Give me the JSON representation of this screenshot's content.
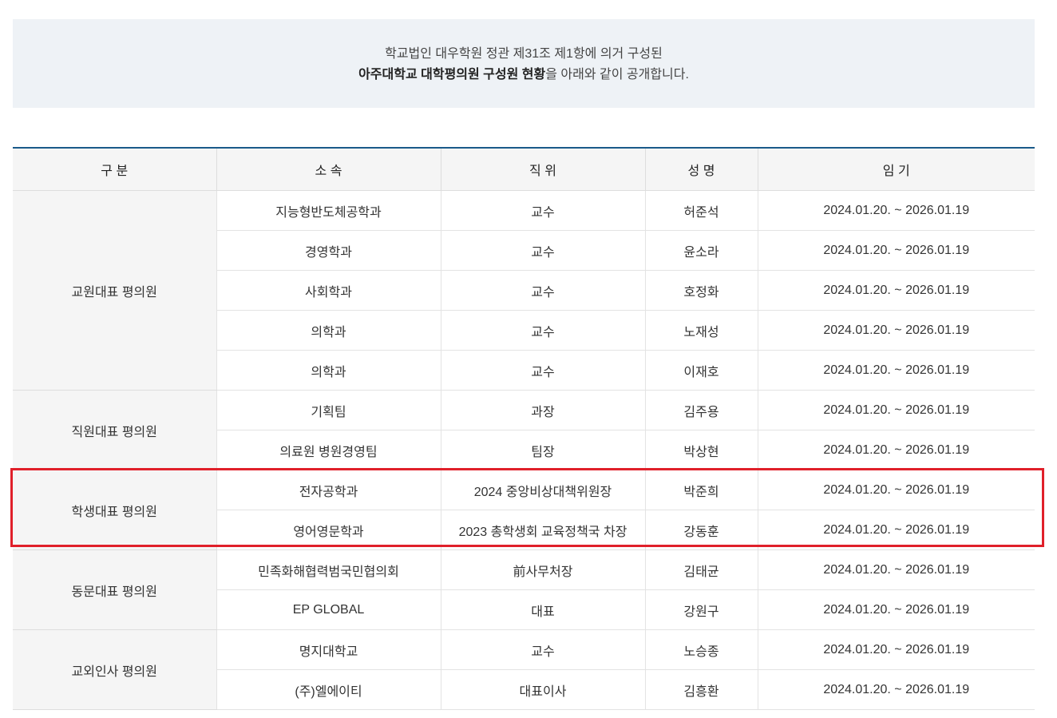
{
  "intro": {
    "line1": "학교법인 대우학원 정관 제31조 제1항에 의거 구성된",
    "line2_bold": "아주대학교 대학평의원 구성원 현황",
    "line2_rest": "을 아래와 같이 공개합니다."
  },
  "table": {
    "headers": [
      "구 분",
      "소 속",
      "직 위",
      "성 명",
      "임 기"
    ],
    "groups": [
      {
        "label": "교원대표 평의원",
        "rows": [
          [
            "지능형반도체공학과",
            "교수",
            "허준석",
            "2024.01.20. ~ 2026.01.19"
          ],
          [
            "경영학과",
            "교수",
            "윤소라",
            "2024.01.20. ~ 2026.01.19"
          ],
          [
            "사회학과",
            "교수",
            "호정화",
            "2024.01.20. ~ 2026.01.19"
          ],
          [
            "의학과",
            "교수",
            "노재성",
            "2024.01.20. ~ 2026.01.19"
          ],
          [
            "의학과",
            "교수",
            "이재호",
            "2024.01.20. ~ 2026.01.19"
          ]
        ]
      },
      {
        "label": "직원대표 평의원",
        "rows": [
          [
            "기획팀",
            "과장",
            "김주용",
            "2024.01.20. ~ 2026.01.19"
          ],
          [
            "의료원 병원경영팀",
            "팀장",
            "박상현",
            "2024.01.20. ~ 2026.01.19"
          ]
        ]
      },
      {
        "label": "학생대표 평의원",
        "rows": [
          [
            "전자공학과",
            "2024 중앙비상대책위원장",
            "박준희",
            "2024.01.20. ~ 2026.01.19"
          ],
          [
            "영어영문학과",
            "2023 총학생회 교육정책국 차장",
            "강동훈",
            "2024.01.20. ~ 2026.01.19"
          ]
        ]
      },
      {
        "label": "동문대표 평의원",
        "rows": [
          [
            "민족화해협력범국민협의회",
            "前사무처장",
            "김태균",
            "2024.01.20. ~ 2026.01.19"
          ],
          [
            "EP GLOBAL",
            "대표",
            "강원구",
            "2024.01.20. ~ 2026.01.19"
          ]
        ]
      },
      {
        "label": "교외인사 평의원",
        "rows": [
          [
            "명지대학교",
            "교수",
            "노승종",
            "2024.01.20. ~ 2026.01.19"
          ],
          [
            "(주)엘에이티",
            "대표이사",
            "김흥환",
            "2024.01.20. ~ 2026.01.19"
          ]
        ]
      }
    ]
  },
  "colors": {
    "intro_bg": "#eef2f6",
    "header_top_border": "#1a5a8a",
    "highlight_border": "#e0202a"
  }
}
